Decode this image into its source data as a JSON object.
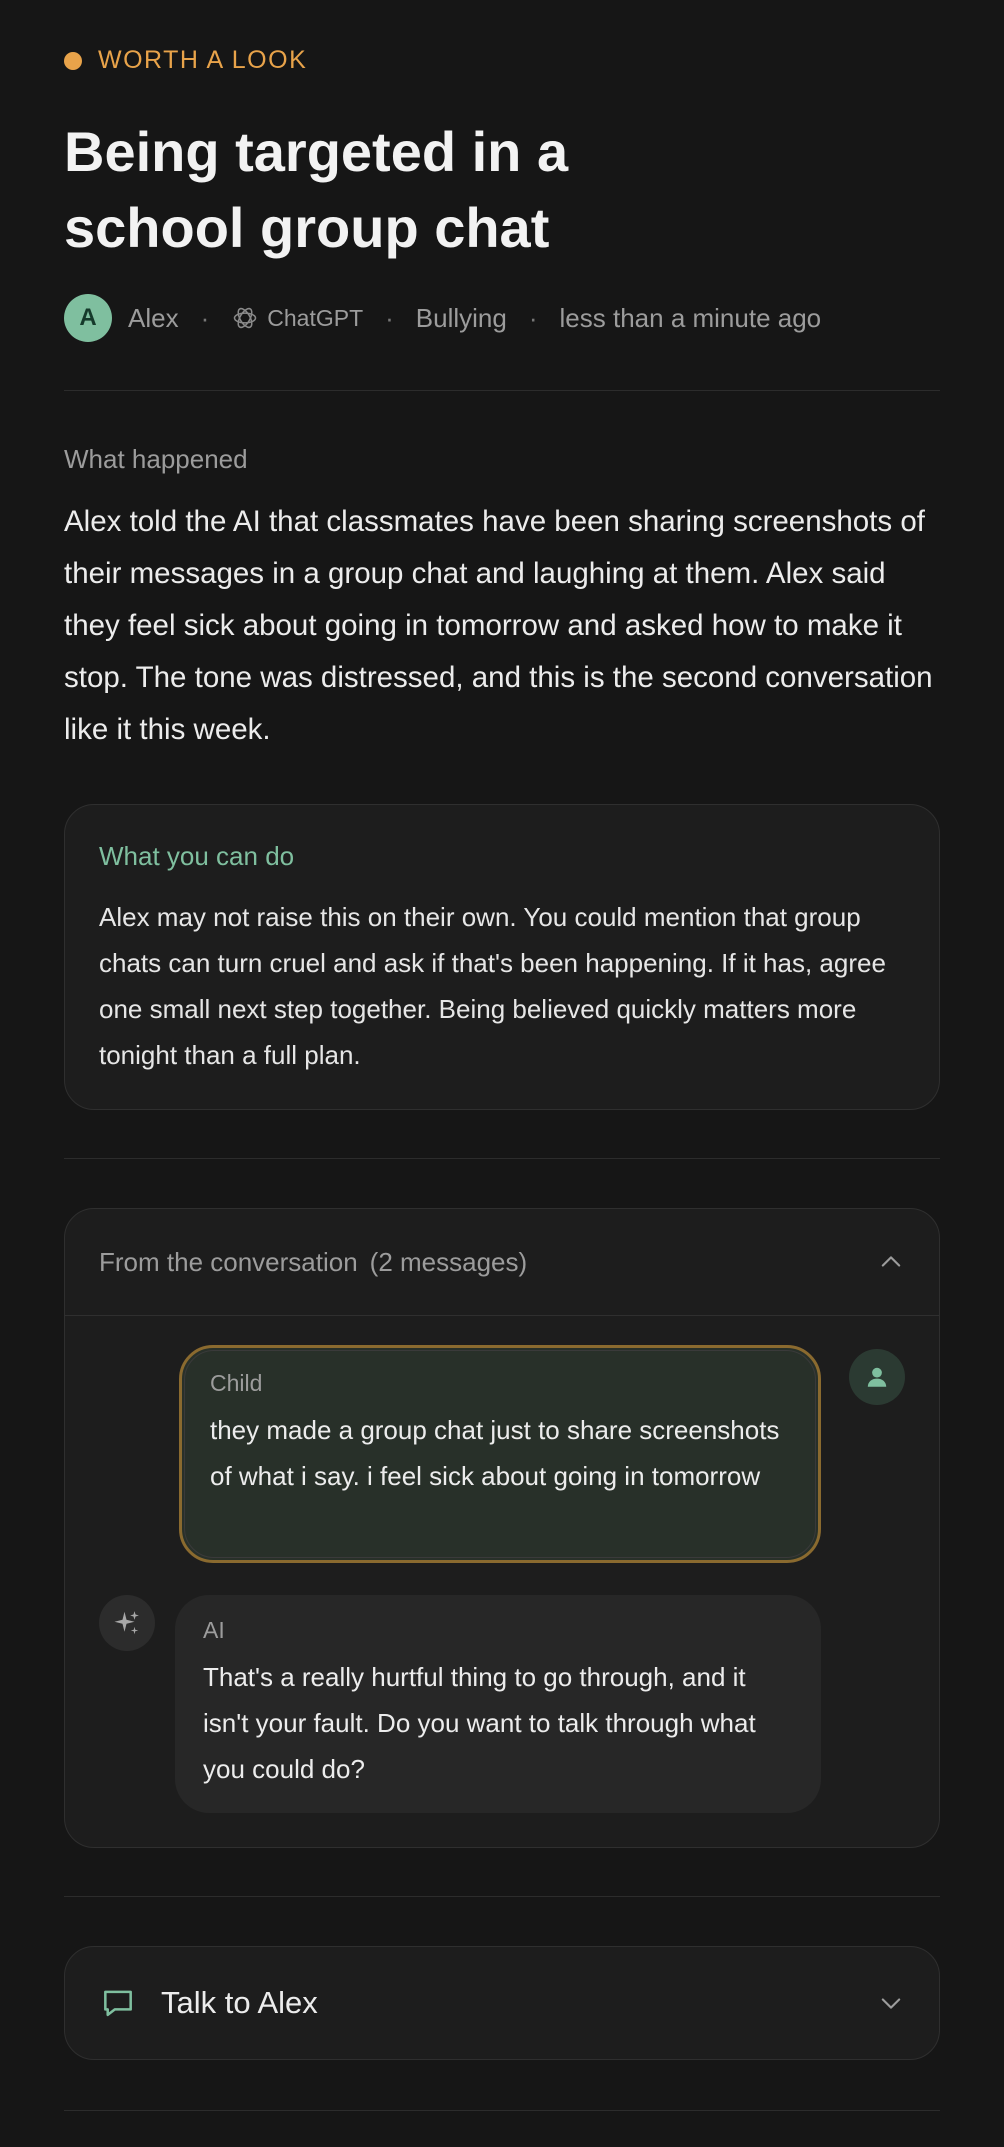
{
  "eyebrow": {
    "label": "WORTH A LOOK",
    "color": "#e8a34a"
  },
  "title": "Being targeted in a school group chat",
  "meta": {
    "avatar_initial": "A",
    "child_name": "Alex",
    "platform": "ChatGPT",
    "platform_icon": "chatgpt-logo-icon",
    "category": "Bullying",
    "time": "less than a minute ago"
  },
  "what_happened": {
    "label": "What happened",
    "text": "Alex told the AI that classmates have been sharing screenshots of their messages in a group chat and laughing at them. Alex said they feel sick about going in tomorrow and asked how to make it stop. The tone was distressed, and this is the second conversation like it this week."
  },
  "what_you_can_do": {
    "label": "What you can do",
    "text": "Alex may not raise this on their own. You could mention that group chats can turn cruel and ask if that's been happening. If it has, agree one small next step together. Being believed quickly matters more tonight than a full plan."
  },
  "conversation": {
    "label": "From the conversation",
    "count": "(2 messages)",
    "expanded": true,
    "messages": [
      {
        "sender": "Child",
        "text": "they made a group chat just to share screenshots of what i say. i feel sick about going in tomorrow",
        "highlighted": true
      },
      {
        "sender": "AI",
        "text": "That's a really hurtful thing to go through, and it isn't your fault. Do you want to talk through what you could do?"
      }
    ]
  },
  "talk": {
    "label": "Talk to Alex",
    "icon": "chat-bubble-icon",
    "expanded": false
  },
  "colors": {
    "background": "#161616",
    "accent_green": "#7fbf9f",
    "accent_amber": "#e8a34a"
  }
}
